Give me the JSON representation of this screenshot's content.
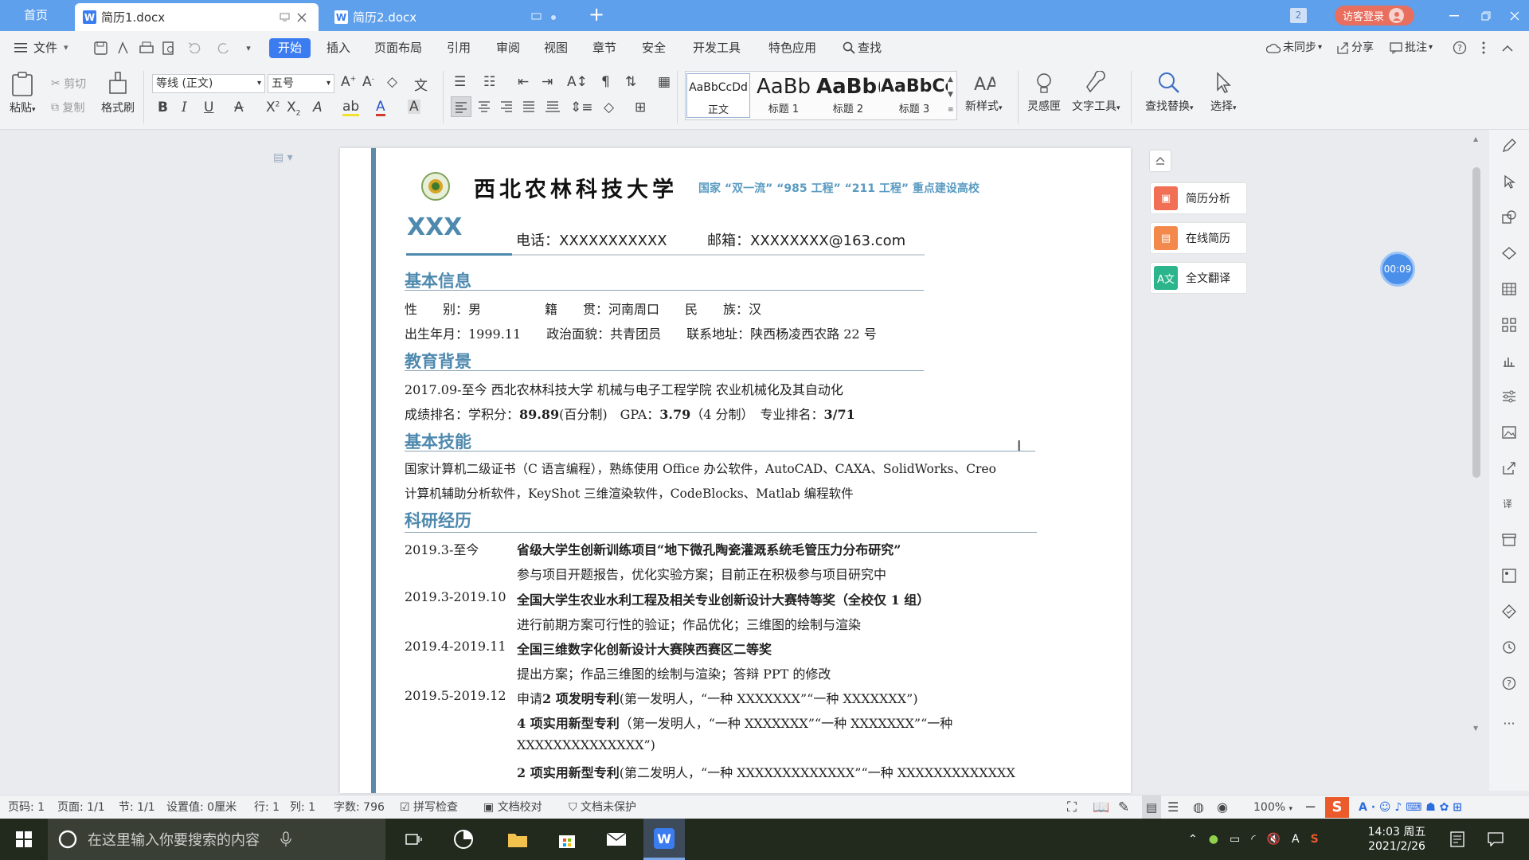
{
  "titlebar": {
    "home_tab": "首页",
    "tab1": "简历1.docx",
    "tab2": "简历2.docx",
    "window_count": "2",
    "login": "访客登录",
    "app_letter": "W"
  },
  "menu": {
    "file": "文件",
    "items": [
      "开始",
      "插入",
      "页面布局",
      "引用",
      "审阅",
      "视图",
      "章节",
      "安全",
      "开发工具",
      "特色应用",
      "查找"
    ],
    "sync": "未同步",
    "share": "分享",
    "comment": "批注"
  },
  "ribbon": {
    "paste": "粘贴",
    "cut": "剪切",
    "copy": "复制",
    "format_painter": "格式刷",
    "font_name": "等线 (正文)",
    "font_size": "五号",
    "styles": [
      {
        "preview": "AaBbCcDd",
        "label": "正文"
      },
      {
        "preview": "AaBb",
        "label": "标题 1"
      },
      {
        "preview": "AaBb(",
        "label": "标题 2"
      },
      {
        "preview": "AaBbCc",
        "label": "标题 3"
      }
    ],
    "new_style": "新样式",
    "inspiration": "灵感匣",
    "text_tools": "文字工具",
    "find_replace": "查找替换",
    "select": "选择"
  },
  "document": {
    "university": "西北农林科技大学",
    "tagline": "国家 “双一流” “985 工程” “211 工程” 重点建设高校",
    "name": "XXX",
    "phone": "电话：XXXXXXXXXXX",
    "email": "邮箱：XXXXXXXX@163.com",
    "sections": {
      "basic": "基本信息",
      "education": "教育背景",
      "skills": "基本技能",
      "research": "科研经历"
    },
    "basic_lines": [
      "性　　别：男　　　　　籍　　贯：河南周口　　民　　族：汉",
      "出生年月：1999.11　　政治面貌：共青团员　　联系地址：陕西杨凌西农路 22 号"
    ],
    "edu_line1": "2017.09-至今 西北农林科技大学 机械与电子工程学院 农业机械化及其自动化",
    "edu_line2": {
      "a": "成绩排名：学积分：",
      "b": "89.89",
      "c": "(百分制)　GPA：",
      "d": "3.79",
      "e": "（4 分制）　专业排名：",
      "f": "3/71"
    },
    "skills_lines": [
      "国家计算机二级证书（C 语言编程），熟练使用 Office 办公软件，AutoCAD、CAXA、SolidWorks、Creo",
      "计算机辅助分析软件，KeyShot 三维渲染软件，CodeBlocks、Matlab 编程软件"
    ],
    "research": [
      {
        "date": "2019.3-至今",
        "title": "省级大学生创新训练项目“地下微孔陶瓷灌溉系统毛管压力分布研究”",
        "detail": "参与项目开题报告，优化实验方案；目前正在积极参与项目研究中"
      },
      {
        "date": "2019.3-2019.10",
        "title": "全国大学生农业水利工程及相关专业创新设计大赛特等奖（全校仅 1 组）",
        "detail": "进行前期方案可行性的验证；作品优化；三维图的绘制与渲染"
      },
      {
        "date": "2019.4-2019.11",
        "title": "全国三维数字化创新设计大赛陕西赛区二等奖",
        "detail": "提出方案；作品三维图的绘制与渲染；答辩 PPT 的修改"
      }
    ],
    "patent": {
      "date": "2019.5-2019.12",
      "line1_a": "申请",
      "line1_b": "2 项发明专利",
      "line1_c": "(第一发明人，“一种 XXXXXXX”“一种 XXXXXXX”)",
      "line2_a": "4 项实用新型专利",
      "line2_b": "（第一发明人，“一种 XXXXXXX”“一种 XXXXXXX”“一种",
      "line3": "XXXXXXXXXXXXXX”)",
      "line4_a": "2 项实用新型专利",
      "line4_b": "(第二发明人，“一种 XXXXXXXXXXXXX”“一种 XXXXXXXXXXXXX"
    }
  },
  "side_panel": {
    "resume_analysis": "简历分析",
    "online_resume": "在线简历",
    "translate": "全文翻译",
    "timer": "00:09"
  },
  "statusbar": {
    "page_code": "页码: 1",
    "page": "页面: 1/1",
    "section": "节: 1/1",
    "setting": "设置值: 0厘米",
    "row": "行: 1",
    "col": "列: 1",
    "words": "字数: 796",
    "spell": "拼写检查",
    "proof": "文档校对",
    "protect": "文档未保护",
    "zoom": "100%"
  },
  "taskbar": {
    "search_placeholder": "在这里输入你要搜索的内容",
    "time": "14:03 周五",
    "date": "2021/2/26"
  },
  "colors": {
    "titlebar": "#5ea0ec",
    "accent": "#3b7df0",
    "section_title": "#4e89ae",
    "page_bar": "#5c8aa8"
  }
}
